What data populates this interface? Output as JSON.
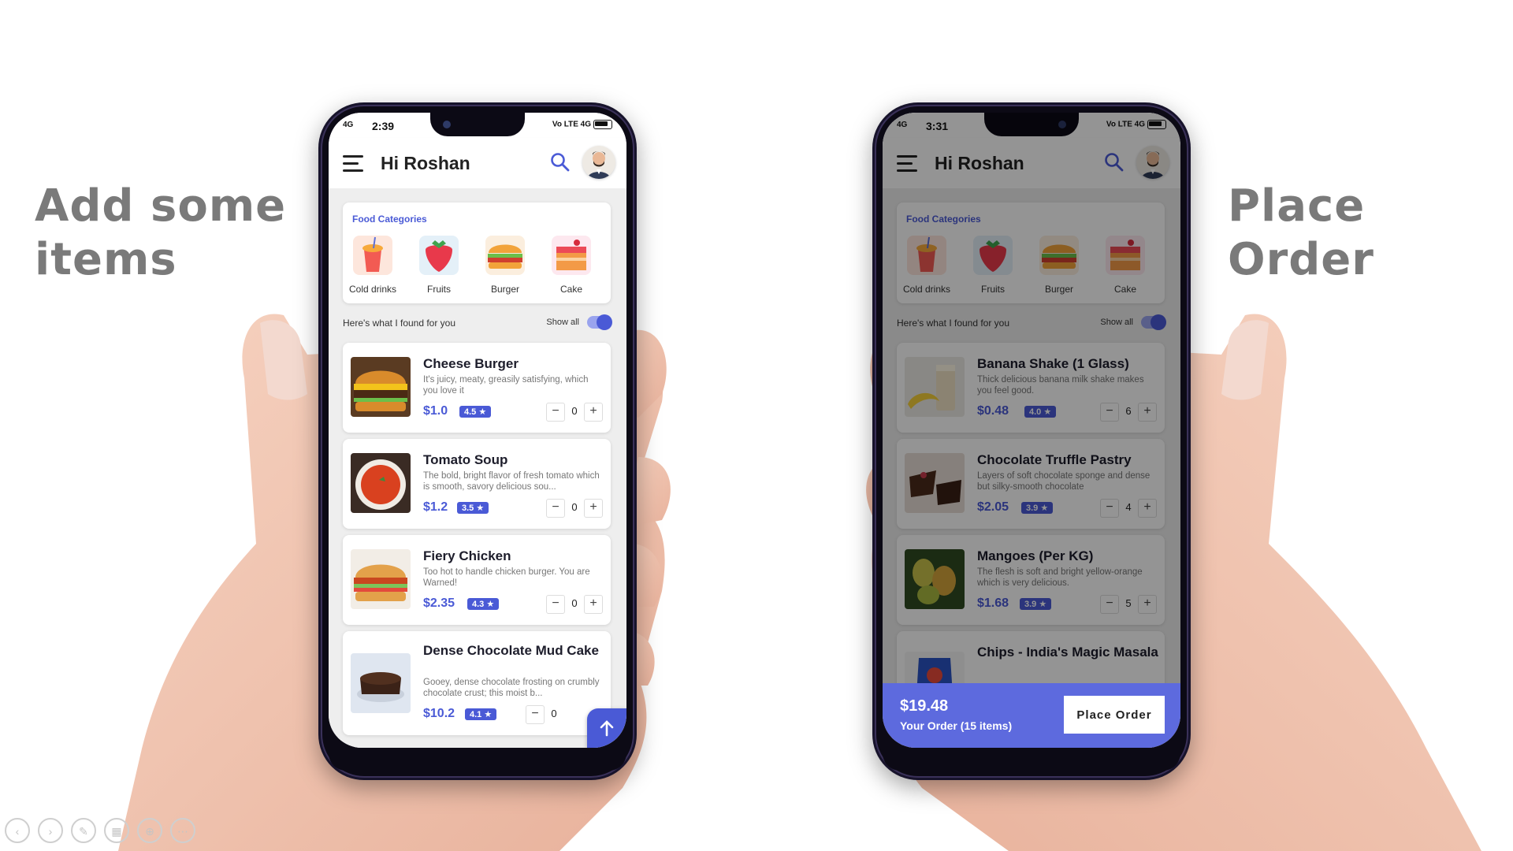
{
  "slide": {
    "left_title": "Add some items",
    "right_title": "Place Order"
  },
  "left_phone": {
    "status": {
      "signal": "4G",
      "time": "2:39",
      "right": "Vo LTE 4G"
    },
    "greeting": "Hi Roshan",
    "categories_title": "Food Categories",
    "categories": [
      {
        "label": "Cold drinks",
        "icon": "cold-drink-icon"
      },
      {
        "label": "Fruits",
        "icon": "strawberry-icon"
      },
      {
        "label": "Burger",
        "icon": "burger-icon"
      },
      {
        "label": "Cake",
        "icon": "cake-icon"
      }
    ],
    "found_text": "Here's what I found for you",
    "show_all": "Show all",
    "items": [
      {
        "name": "Cheese Burger",
        "desc": "It's juicy, meaty, greasily satisfying, which you love it",
        "price": "$1.0",
        "rating": "4.5 ★",
        "qty": "0"
      },
      {
        "name": "Tomato Soup",
        "desc": "The bold, bright flavor of fresh tomato which is smooth, savory delicious sou...",
        "price": "$1.2",
        "rating": "3.5 ★",
        "qty": "0"
      },
      {
        "name": "Fiery Chicken",
        "desc": "Too hot to handle chicken burger. You are Warned!",
        "price": "$2.35",
        "rating": "4.3 ★",
        "qty": "0"
      },
      {
        "name": "Dense Chocolate Mud Cake",
        "desc": "Gooey, dense chocolate frosting on crumbly chocolate crust; this moist b...",
        "price": "$10.2",
        "rating": "4.1 ★",
        "qty": "0"
      }
    ]
  },
  "right_phone": {
    "status": {
      "signal": "4G",
      "time": "3:31",
      "right": "Vo LTE 4G"
    },
    "greeting": "Hi Roshan",
    "categories_title": "Food Categories",
    "categories": [
      {
        "label": "Cold drinks",
        "icon": "cold-drink-icon"
      },
      {
        "label": "Fruits",
        "icon": "strawberry-icon"
      },
      {
        "label": "Burger",
        "icon": "burger-icon"
      },
      {
        "label": "Cake",
        "icon": "cake-icon"
      }
    ],
    "found_text": "Here's what I found for you",
    "show_all": "Show all",
    "items": [
      {
        "name": "Banana Shake (1 Glass)",
        "desc": "Thick delicious banana milk shake makes you feel good.",
        "price": "$0.48",
        "rating": "4.0 ★",
        "qty": "6"
      },
      {
        "name": "Chocolate Truffle Pastry",
        "desc": "Layers of soft chocolate sponge and dense but silky-smooth chocolate",
        "price": "$2.05",
        "rating": "3.9 ★",
        "qty": "4"
      },
      {
        "name": "Mangoes (Per KG)",
        "desc": "The flesh is soft and bright yellow-orange which is very delicious.",
        "price": "$1.68",
        "rating": "3.9 ★",
        "qty": "5"
      },
      {
        "name": "Chips - India's Magic Masala"
      }
    ],
    "order": {
      "total": "$19.48",
      "count": "Your Order (15 items)",
      "button": "Place Order"
    }
  },
  "colors": {
    "accent": "#4a5ad6",
    "order_bar": "#5d6ade",
    "title_gray": "#7a7a7a"
  },
  "toolbar_icons": [
    "prev-icon",
    "play-icon",
    "pen-icon",
    "slides-icon",
    "zoom-icon",
    "more-icon"
  ]
}
